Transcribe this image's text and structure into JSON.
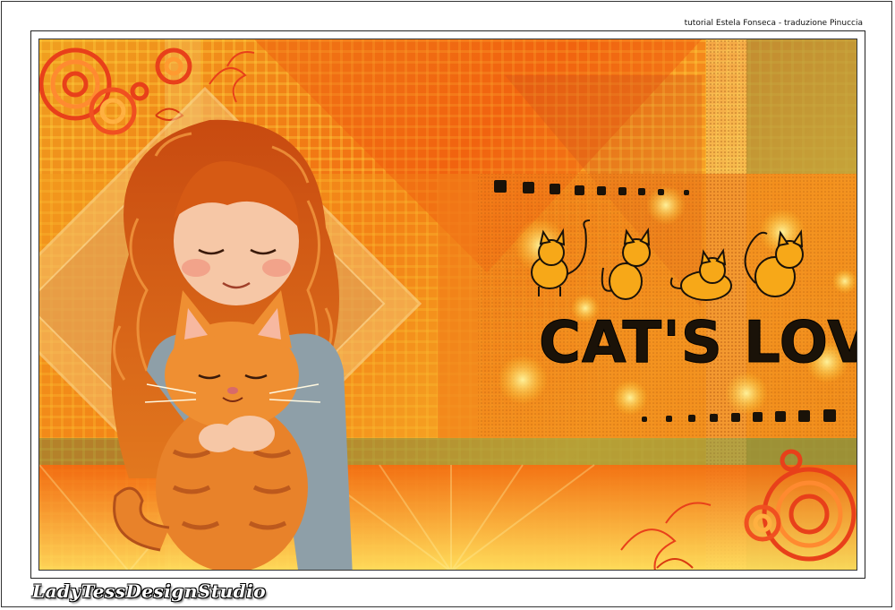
{
  "credit": "tutorial Estela Fonseca - traduzione Pinuccia",
  "title": "CAT'S LOVER",
  "signature": "LadyTessDesignStudio",
  "colors": {
    "orange": "#f26a10",
    "yellow": "#f9c030",
    "red_orange": "#e8401a",
    "olive": "#8a8a3a",
    "black": "#1a1208"
  }
}
